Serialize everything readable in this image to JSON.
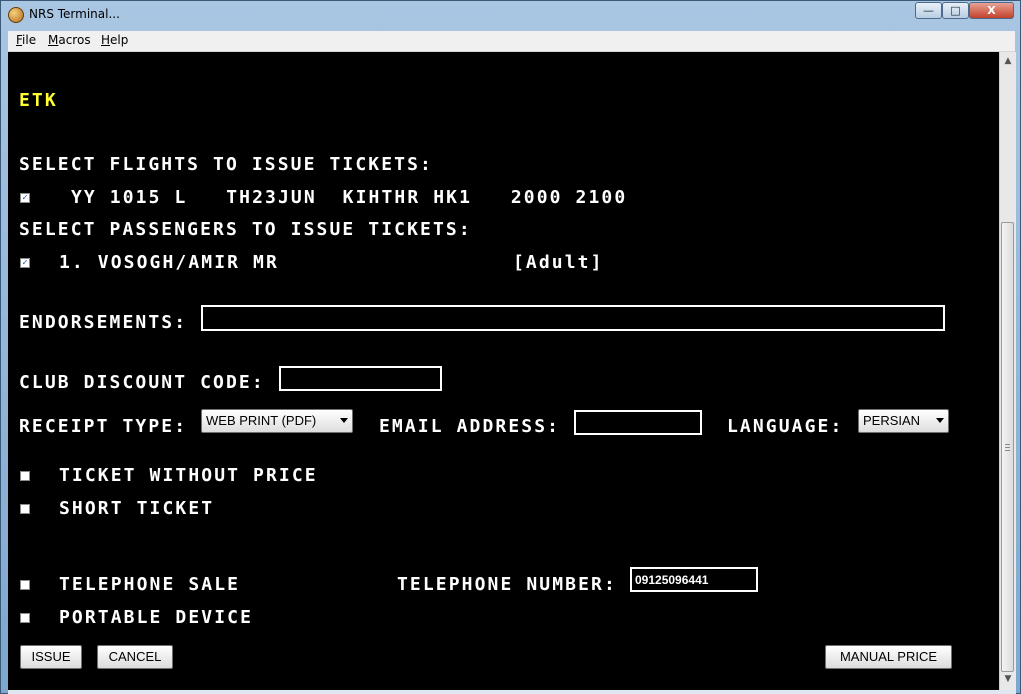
{
  "window": {
    "title": "NRS Terminal...",
    "icon": "nrs-app-icon",
    "controls": {
      "minimize": "—",
      "maximize": "□",
      "close": "X"
    }
  },
  "menubar": {
    "items": [
      {
        "label": "File",
        "mnemonic": "F",
        "rest": "ile"
      },
      {
        "label": "Macros",
        "mnemonic": "M",
        "rest": "acros"
      },
      {
        "label": "Help",
        "mnemonic": "H",
        "rest": "elp"
      }
    ]
  },
  "terminal": {
    "heading": "ETK",
    "flights_label": "SELECT FLIGHTS TO ISSUE TICKETS:",
    "flight_line": "YY 1015 L   TH23JUN  KIHTHR HK1   2000 2100",
    "flight_checked": true,
    "passengers_label": "SELECT PASSENGERS TO ISSUE TICKETS:",
    "passenger_line": "1. VOSOGH/AMIR MR",
    "passenger_type": "[Adult]",
    "passenger_checked": true,
    "endorsements_label": "ENDORSEMENTS:",
    "endorsements_value": "",
    "club_label": "CLUB DISCOUNT CODE:",
    "club_value": "",
    "receipt_label": "RECEIPT TYPE:",
    "receipt_value": "WEB PRINT (PDF)",
    "email_label": "EMAIL ADDRESS:",
    "email_value": "",
    "language_label": "LANGUAGE:",
    "language_value": "PERSIAN",
    "ticket_without_price": "TICKET WITHOUT PRICE",
    "short_ticket": "SHORT TICKET",
    "telephone_sale": "TELEPHONE SALE",
    "telephone_number_label": "TELEPHONE NUMBER:",
    "telephone_number_value": "09125096441",
    "portable_device": "PORTABLE DEVICE",
    "buttons": {
      "issue": "ISSUE",
      "cancel": "CANCEL",
      "manual_price": "MANUAL PRICE"
    }
  },
  "colors": {
    "background": "#000000",
    "text": "#ffffff",
    "heading": "#ffff33"
  }
}
